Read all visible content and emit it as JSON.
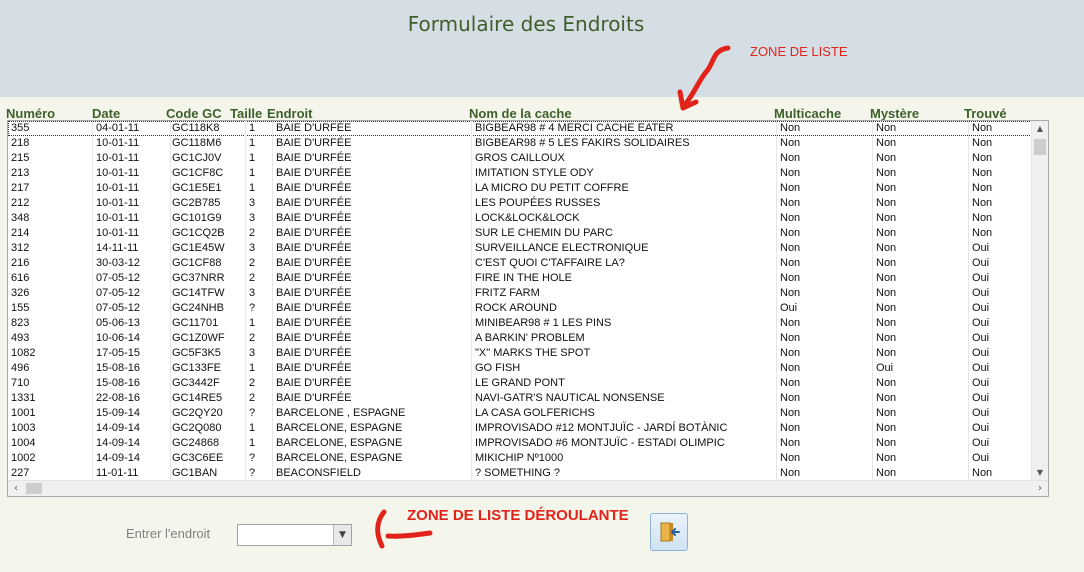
{
  "header": {
    "title": "Formulaire des Endroits"
  },
  "annotations": {
    "list_label": "ZONE DE LISTE",
    "dropdown_label": "ZONE DE LISTE DÉROULANTE"
  },
  "columns": [
    "Numéro",
    "Date",
    "Code GC",
    "Taille",
    "Endroit",
    "Nom de la cache",
    "Multicache",
    "Mystère",
    "Trouvé"
  ],
  "rows": [
    [
      "355",
      "04-01-11",
      "GC118K8",
      "1",
      "BAIE D'URFÉE",
      "BIGBEAR98 # 4 MERCI CACHE EATER",
      "Non",
      "Non",
      "Non"
    ],
    [
      "218",
      "10-01-11",
      "GC118M6",
      "1",
      "BAIE D'URFÉE",
      "BIGBEAR98 # 5 LES FAKIRS SOLIDAIRES",
      "Non",
      "Non",
      "Non"
    ],
    [
      "215",
      "10-01-11",
      "GC1CJ0V",
      "1",
      "BAIE D'URFÉE",
      "GROS CAILLOUX",
      "Non",
      "Non",
      "Non"
    ],
    [
      "213",
      "10-01-11",
      "GC1CF8C",
      "1",
      "BAIE D'URFÉE",
      "IMITATION STYLE ODY",
      "Non",
      "Non",
      "Non"
    ],
    [
      "217",
      "10-01-11",
      "GC1E5E1",
      "1",
      "BAIE D'URFÉE",
      "LA MICRO DU PETIT COFFRE",
      "Non",
      "Non",
      "Non"
    ],
    [
      "212",
      "10-01-11",
      "GC2B785",
      "3",
      "BAIE D'URFÉE",
      "LES POUPÉES RUSSES",
      "Non",
      "Non",
      "Non"
    ],
    [
      "348",
      "10-01-11",
      "GC101G9",
      "3",
      "BAIE D'URFÉE",
      "LOCK&LOCK&LOCK",
      "Non",
      "Non",
      "Non"
    ],
    [
      "214",
      "10-01-11",
      "GC1CQ2B",
      "2",
      "BAIE D'URFÉE",
      "SUR LE CHEMIN DU PARC",
      "Non",
      "Non",
      "Non"
    ],
    [
      "312",
      "14-11-11",
      "GC1E45W",
      "3",
      "BAIE D'URFÉE",
      "SURVEILLANCE ELECTRONIQUE",
      "Non",
      "Non",
      "Oui"
    ],
    [
      "216",
      "30-03-12",
      "GC1CF88",
      "2",
      "BAIE D'URFÉE",
      "C'EST QUOI C'TAFFAIRE LA?",
      "Non",
      "Non",
      "Oui"
    ],
    [
      "616",
      "07-05-12",
      "GC37NRR",
      "2",
      "BAIE D'URFÉE",
      "FIRE IN THE HOLE",
      "Non",
      "Non",
      "Oui"
    ],
    [
      "326",
      "07-05-12",
      "GC14TFW",
      "3",
      "BAIE D'URFÉE",
      "FRITZ FARM",
      "Non",
      "Non",
      "Oui"
    ],
    [
      "155",
      "07-05-12",
      "GC24NHB",
      "?",
      "BAIE D'URFÉE",
      "ROCK AROUND",
      "Oui",
      "Non",
      "Oui"
    ],
    [
      "823",
      "05-06-13",
      "GC11701",
      "1",
      "BAIE D'URFÉE",
      "MINIBEAR98 # 1 LES PINS",
      "Non",
      "Non",
      "Oui"
    ],
    [
      "493",
      "10-06-14",
      "GC1Z0WF",
      "2",
      "BAIE D'URFÉE",
      "A BARKIN' PROBLEM",
      "Non",
      "Non",
      "Oui"
    ],
    [
      "1082",
      "17-05-15",
      "GC5F3K5",
      "3",
      "BAIE D'URFÉE",
      "\"X\" MARKS THE SPOT",
      "Non",
      "Non",
      "Oui"
    ],
    [
      "496",
      "15-08-16",
      "GC133FE",
      "1",
      "BAIE D'URFÉE",
      "GO FISH",
      "Non",
      "Oui",
      "Oui"
    ],
    [
      "710",
      "15-08-16",
      "GC3442F",
      "2",
      "BAIE D'URFÉE",
      "LE GRAND PONT",
      "Non",
      "Non",
      "Oui"
    ],
    [
      "1331",
      "22-08-16",
      "GC14RE5",
      "2",
      "BAIE D'URFÉE",
      "NAVI-GATR'S NAUTICAL NONSENSE",
      "Non",
      "Non",
      "Oui"
    ],
    [
      "1001",
      "15-09-14",
      "GC2QY20",
      "?",
      "BARCELONE , ESPAGNE",
      "LA CASA GOLFERICHS",
      "Non",
      "Non",
      "Oui"
    ],
    [
      "1003",
      "14-09-14",
      "GC2Q080",
      "1",
      "BARCELONE, ESPAGNE",
      "IMPROVISADO #12 MONTJUÏC - JARDÍ BOTÀNIC",
      "Non",
      "Non",
      "Oui"
    ],
    [
      "1004",
      "14-09-14",
      "GC24868",
      "1",
      "BARCELONE, ESPAGNE",
      "IMPROVISADO #6 MONTJUÏC - ESTADI OLIMPIC",
      "Non",
      "Non",
      "Oui"
    ],
    [
      "1002",
      "14-09-14",
      "GC3C6EE",
      "?",
      "BARCELONE, ESPAGNE",
      "MIKICHIP Nº1000",
      "Non",
      "Non",
      "Oui"
    ],
    [
      "227",
      "11-01-11",
      "GC1BAN",
      "?",
      "BEACONSFIELD",
      "? SOMETHING ?",
      "Non",
      "Non",
      "Non"
    ]
  ],
  "combo": {
    "label": "Entrer l'endroit",
    "value": ""
  },
  "icons": {
    "dropdown": "chevron-down-icon",
    "exit": "exit-door-icon",
    "scroll_up": "scroll-up-icon",
    "scroll_down": "scroll-down-icon",
    "scroll_left": "scroll-left-icon",
    "scroll_right": "scroll-right-icon"
  },
  "colors": {
    "header_bg": "#d5dde5",
    "title": "#3f5f2a",
    "annotation": "#e2231a"
  }
}
